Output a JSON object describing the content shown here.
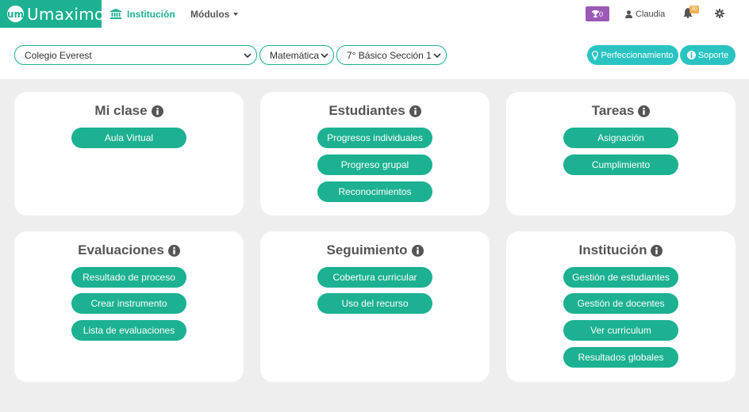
{
  "brand": {
    "logo_mark": "um",
    "name": "Umaximo"
  },
  "nav": {
    "institution_label": "Institución",
    "modules_label": "Módulos",
    "trophy_count": "0",
    "user_name": "Claudia",
    "notifications_count": "30"
  },
  "filters": {
    "school": "Colegio Everest",
    "subject": "Matemática",
    "course": "7° Básico Sección 1",
    "improvement_label": "Perfeccionamiento",
    "support_label": "Soporte"
  },
  "cards": [
    {
      "title": "Mi clase",
      "buttons": [
        "Aula Virtual"
      ]
    },
    {
      "title": "Estudiantes",
      "buttons": [
        "Progresos individuales",
        "Progreso grupal",
        "Reconocimientos"
      ]
    },
    {
      "title": "Tareas",
      "buttons": [
        "Asignación",
        "Cumplimiento"
      ]
    },
    {
      "title": "Evaluaciones",
      "buttons": [
        "Resultado de proceso",
        "Crear instrumento",
        "Lista de evaluaciones"
      ]
    },
    {
      "title": "Seguimiento",
      "buttons": [
        "Cobertura curricular",
        "Uso del recurso"
      ]
    },
    {
      "title": "Institución",
      "buttons": [
        "Gestión de estudiantes",
        "Gestión de docentes",
        "Ver curriculum",
        "Resultados globales"
      ]
    }
  ],
  "colors": {
    "brand": "#1bb191",
    "accent": "#29c4c1",
    "trophy": "#9b59b6",
    "badge": "#f0ad4e",
    "background": "#eeeeee"
  },
  "icons": [
    "institution-icon",
    "trophy-icon",
    "user-icon",
    "bell-icon",
    "gear-icon",
    "lightbulb-icon",
    "info-icon",
    "chevron-down-icon"
  ]
}
